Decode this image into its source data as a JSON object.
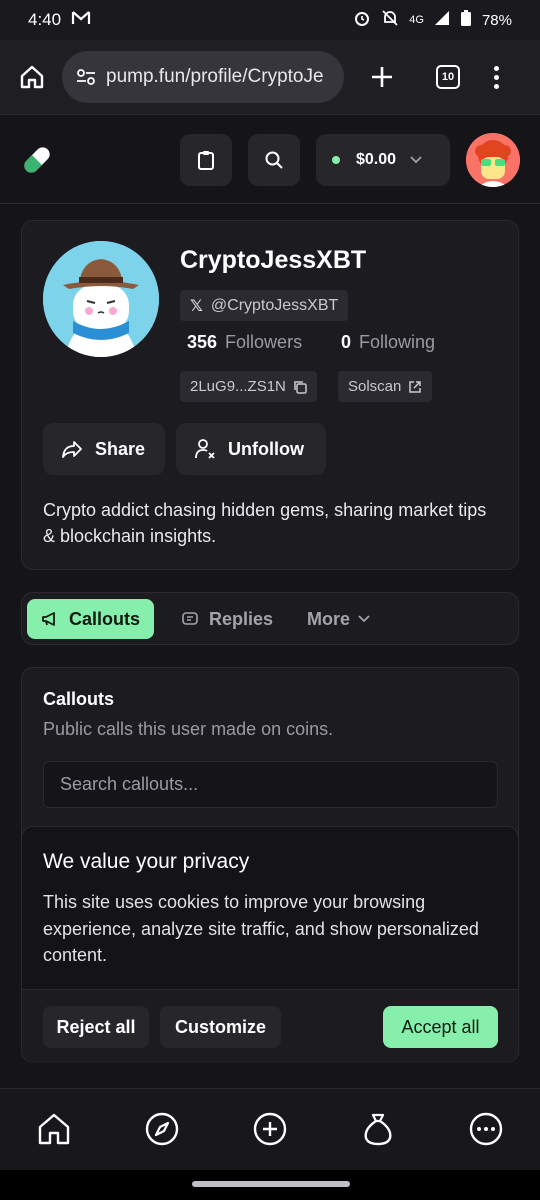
{
  "status": {
    "time": "4:40",
    "network": "4G",
    "battery": "78%"
  },
  "browser": {
    "url": "pump.fun/profile/CryptoJe",
    "tab_count": "10"
  },
  "header": {
    "wallet_balance": "$0.00"
  },
  "profile": {
    "name": "CryptoJessXBT",
    "x_handle": "@CryptoJessXBT",
    "followers_count": "356",
    "followers_label": "Followers",
    "following_count": "0",
    "following_label": "Following",
    "address": "2LuG9...ZS1N",
    "solscan_label": "Solscan",
    "share_label": "Share",
    "unfollow_label": "Unfollow",
    "bio": "Crypto addict chasing hidden gems, sharing market tips & blockchain insights."
  },
  "tabs": [
    {
      "label": "Callouts",
      "active": true
    },
    {
      "label": "Replies",
      "active": false
    },
    {
      "label": "More",
      "active": false
    }
  ],
  "callouts": {
    "title": "Callouts",
    "subtitle": "Public calls this user made on coins.",
    "search_placeholder": "Search callouts..."
  },
  "privacy": {
    "title": "We value your privacy",
    "body": "This site uses cookies to improve your browsing experience, analyze site traffic, and show personalized content.",
    "reject_label": "Reject all",
    "customize_label": "Customize",
    "accept_label": "Accept all"
  },
  "colors": {
    "accent": "#86efac",
    "background": "#151519",
    "card": "#1b1b20"
  },
  "icons": {
    "bottom_nav": [
      "home-icon",
      "compass-icon",
      "plus-circle-icon",
      "money-bag-icon",
      "more-circle-icon"
    ]
  }
}
